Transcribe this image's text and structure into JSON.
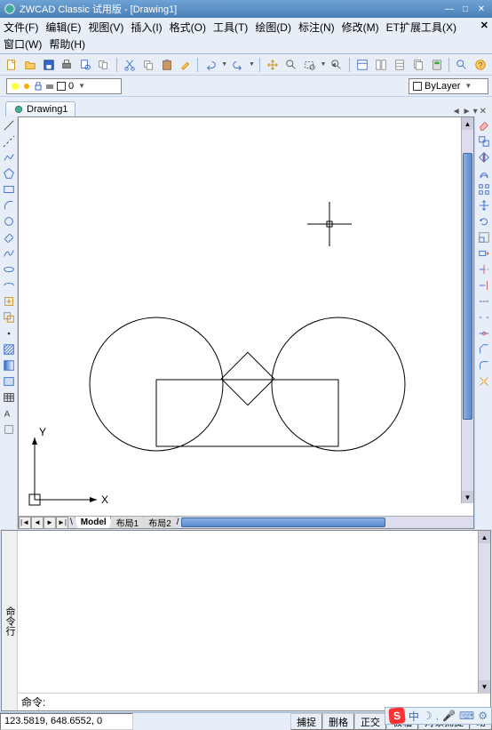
{
  "title": "ZWCAD Classic 试用版 - [Drawing1]",
  "menu": {
    "file": "文件(F)",
    "edit": "编辑(E)",
    "view": "视图(V)",
    "insert": "插入(I)",
    "format": "格式(O)",
    "tools": "工具(T)",
    "draw": "绘图(D)",
    "dim": "标注(N)",
    "modify": "修改(M)",
    "et": "ET扩展工具(X)",
    "window": "窗口(W)",
    "help": "帮助(H)"
  },
  "icons": {
    "new": "new",
    "open": "open",
    "save": "save",
    "print": "print",
    "preview": "preview",
    "publish": "publish",
    "cut": "cut",
    "copy": "copy",
    "paste": "paste",
    "match": "match",
    "undo": "undo",
    "redo": "redo",
    "pan": "pan",
    "zoomrt": "zoomrt",
    "zoomwin": "zoomwin",
    "zoomprev": "zoomprev",
    "prop": "prop",
    "dc": "dc",
    "tool": "tool",
    "sheet": "sheet",
    "calc": "calc",
    "help": "help"
  },
  "layerbar": {
    "layer0": "0",
    "color_combo": "ByLayer"
  },
  "docTab": "Drawing1",
  "layoutTabs": {
    "model": "Model",
    "l1": "布局1",
    "l2": "布局2"
  },
  "cmd": {
    "panel_label": "命令行",
    "prompt": "命令:"
  },
  "status": {
    "coords": "123.5819, 648.6552, 0",
    "snap": "捕捉",
    "grid": "删格",
    "ortho": "正交",
    "polar": "极轴",
    "osnap": "对象捕捉",
    "dyn": "动"
  },
  "ime": {
    "zhong": "中",
    "items": [
      "moon",
      "mic",
      "keyboard",
      "gear"
    ]
  },
  "ucs": {
    "x": "X",
    "y": "Y"
  }
}
